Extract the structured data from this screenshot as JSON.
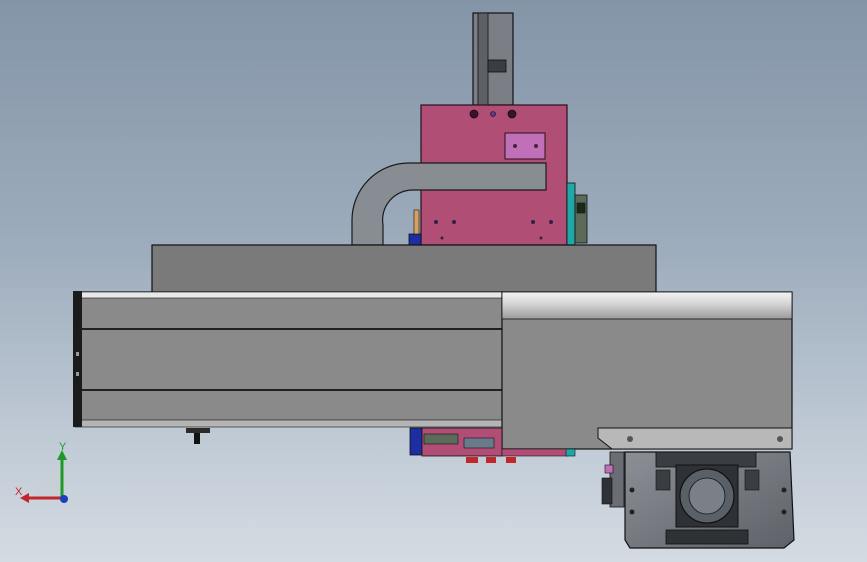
{
  "view": {
    "background_top": "#8495a8",
    "background_bottom": "#d4dbe2"
  },
  "triad": {
    "x_label": "X",
    "y_label": "Y",
    "x_color": "#c0262a",
    "y_color": "#1e9a2a",
    "z_color": "#1a3fbf"
  },
  "colors": {
    "carriage_plate": "#b04e76",
    "rail_body": "#8a8a8a",
    "base_plate": "#7a7a7a",
    "motor_housing": "#6e7278",
    "cable_chain": "#888c93"
  }
}
